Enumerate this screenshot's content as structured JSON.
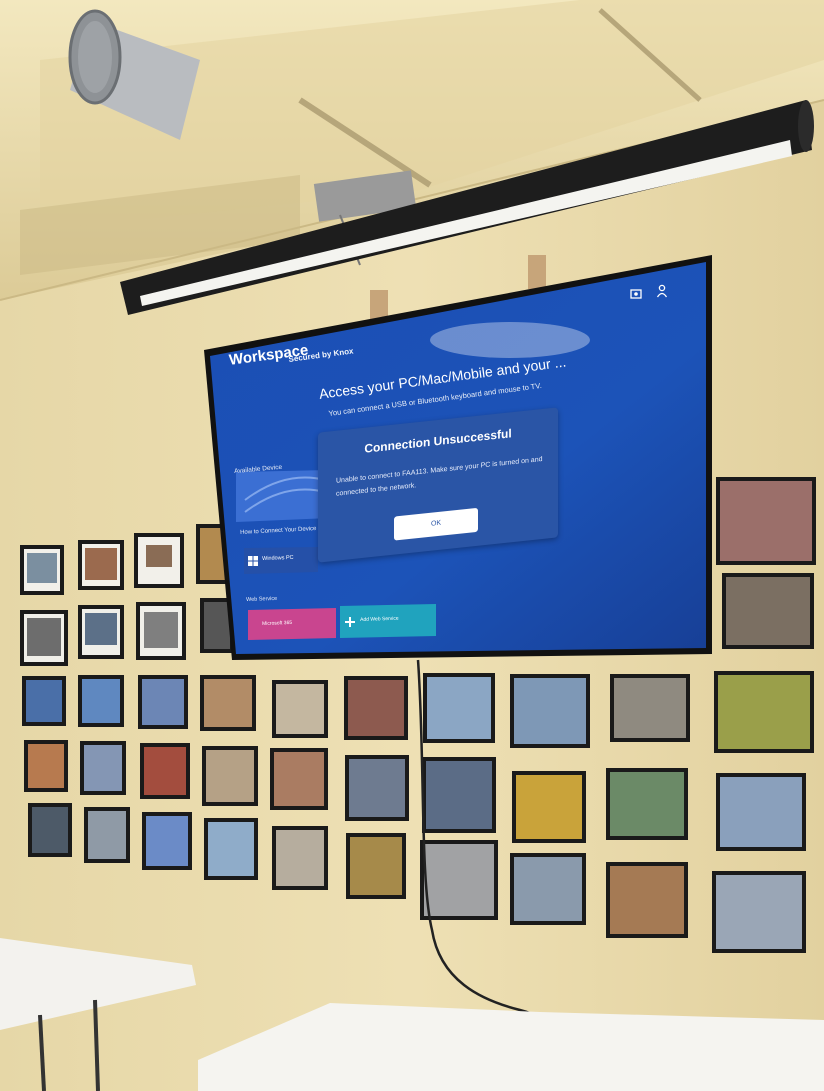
{
  "tv": {
    "app_title": "Workspace",
    "secured_by": "Secured by Knox",
    "headline": "Access your PC/Mac/Mobile and your ...",
    "subline": "You can connect a USB or Bluetooth keyboard and mouse to TV.",
    "available_device_label": "Available Device",
    "how_to_connect_label": "How to Connect Your Device",
    "windows_pc_label": "Windows PC",
    "web_service_label": "Web Service",
    "microsoft_label": "Microsoft 365",
    "add_web_service_label": "Add Web Service",
    "dialog": {
      "title": "Connection Unsuccessful",
      "message": "Unable to connect to FAA113. Make sure your PC is turned on and connected to the network.",
      "ok_label": "OK"
    }
  },
  "colors": {
    "wall": "#e9dcae",
    "screen_blue": "#1e4fb0",
    "dialog_blue": "#2a55a6",
    "ceiling": "#efe3b5",
    "frame": "#1a1a1a"
  },
  "icons": [
    "settings-icon",
    "person-icon",
    "plus-icon",
    "windows-icon"
  ]
}
